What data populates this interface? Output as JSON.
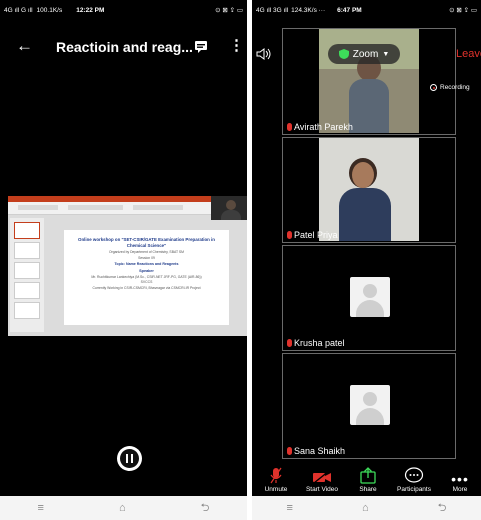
{
  "left": {
    "status": {
      "network": "4G ıll G ıll",
      "speed": "100.1K/s",
      "time": "12:22 PM",
      "icons_right": "⊙ ⊠ ⇪ ▭"
    },
    "header": {
      "title": "Reactioin and reag..."
    },
    "slide": {
      "title": "Online workshop on \"SET-CSIR/GATE Examination Preparation in Chemical Science\"",
      "org": "Organized by Department of Chemistry, SBAT SM",
      "session": "Session 09",
      "topic": "Topic: Name Reactions and Reagents",
      "speaker_label": "Speaker",
      "speaker": "Mr. Ruchitkumar Lankechiya (M.Sc., CSIR-NET JRF-PG, GATE (AIR-86))",
      "speaker2": "SVCCS",
      "footer": "Currently Working in CSIR-CSMCRI, Bhavnagar via CSMCRI-IR Project"
    }
  },
  "right": {
    "status": {
      "network": "4G ıll 3G ıll",
      "speed": "124.3K/s ···",
      "time": "6:47 PM",
      "icons_right": "⊙ ⊠ ⇪ ▭"
    },
    "top": {
      "zoom_label": "Zoom",
      "leave_label": "Leave",
      "recording_label": "Recording"
    },
    "participants": [
      {
        "name": "Avirath Parekh"
      },
      {
        "name": "Patel Priya"
      },
      {
        "name": "Krusha patel"
      },
      {
        "name": "Sana Shaikh"
      }
    ],
    "toolbar": [
      {
        "label": "Unmute",
        "icon": "mic-muted-icon"
      },
      {
        "label": "Start Video",
        "icon": "video-off-icon"
      },
      {
        "label": "Share",
        "icon": "share-icon"
      },
      {
        "label": "Participants",
        "icon": "participants-icon"
      },
      {
        "label": "More",
        "icon": "more-icon"
      }
    ]
  },
  "nav": {
    "menu": "≡",
    "home": "⌂",
    "back": "⮌"
  },
  "colors": {
    "green": "#3ddc5a",
    "red": "#e0322c",
    "slide_blue": "#1f3b8a",
    "ppt_ribbon": "#c43e1c"
  }
}
